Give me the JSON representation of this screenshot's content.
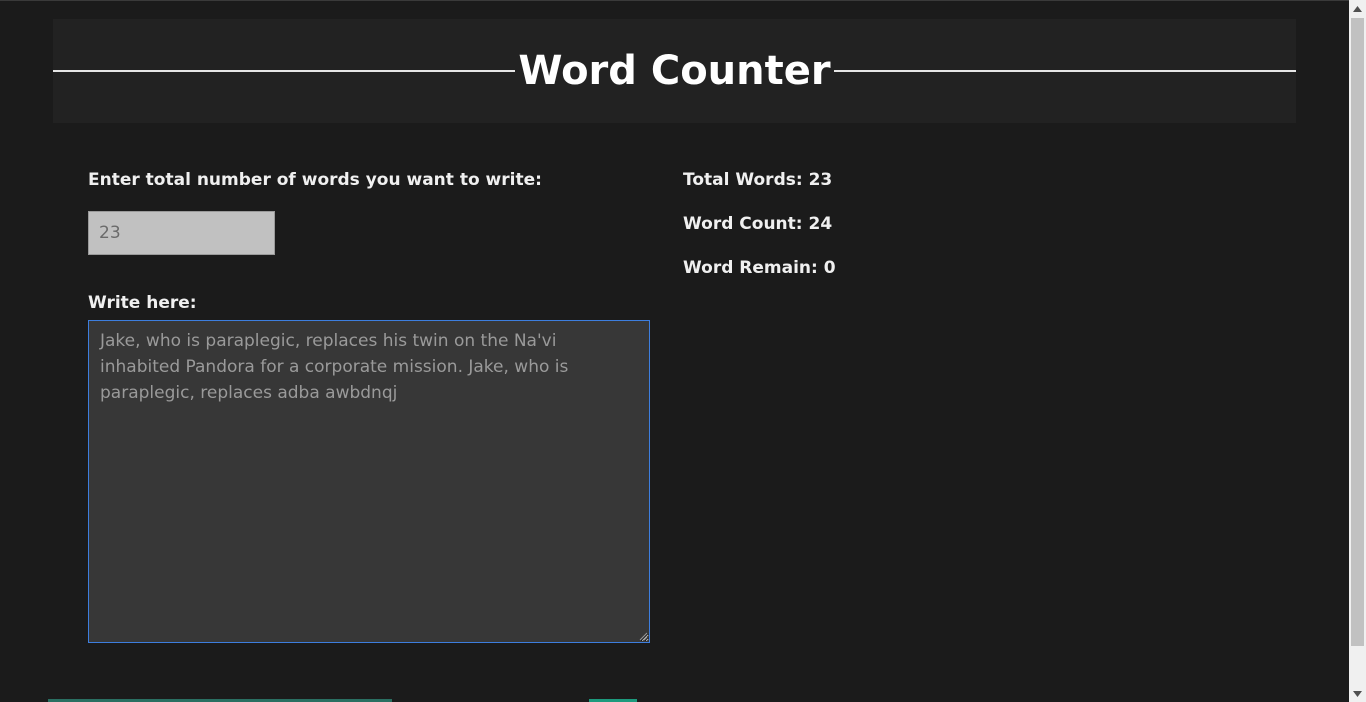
{
  "header": {
    "title": "Word Counter"
  },
  "form": {
    "target_label": "Enter total number of words you want to write:",
    "target_value": "23",
    "write_label": "Write here:",
    "text": "Jake, who is paraplegic, replaces his twin on the Na'vi inhabited Pandora for a corporate mission. Jake, who is paraplegic, replaces adba awbdnqj"
  },
  "stats": {
    "total_words": "Total Words: 23",
    "word_count": "Word Count: 24",
    "word_remain": "Word Remain: 0"
  },
  "colors": {
    "background": "#1b1b1b",
    "header_bg": "#222222",
    "textarea_bg": "#373737",
    "focus_border": "#3d7ede"
  }
}
